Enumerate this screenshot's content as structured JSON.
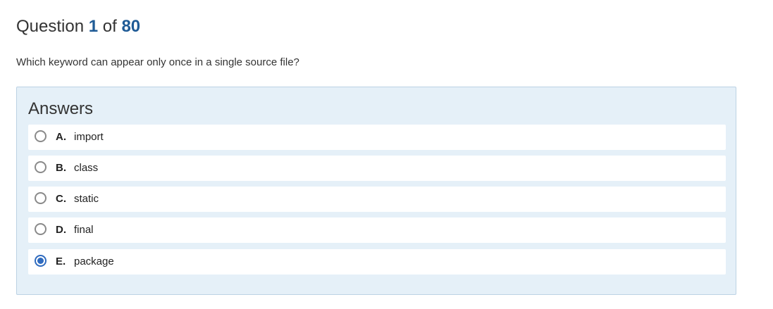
{
  "question": {
    "label": "Question",
    "current": "1",
    "of_label": "of",
    "total": "80",
    "text": "Which keyword can appear only once in a single source file?"
  },
  "answers": {
    "heading": "Answers",
    "selected": "E",
    "options": [
      {
        "letter": "A.",
        "text": "import",
        "selected": false
      },
      {
        "letter": "B.",
        "text": "class",
        "selected": false
      },
      {
        "letter": "C.",
        "text": "static",
        "selected": false
      },
      {
        "letter": "D.",
        "text": "final",
        "selected": false
      },
      {
        "letter": "E.",
        "text": "package",
        "selected": true
      }
    ]
  },
  "colors": {
    "accent": "#1f5b96",
    "panel_background": "#e5f0f8",
    "panel_border": "#bcd2e4",
    "radio_selected": "#2f6bbf"
  }
}
